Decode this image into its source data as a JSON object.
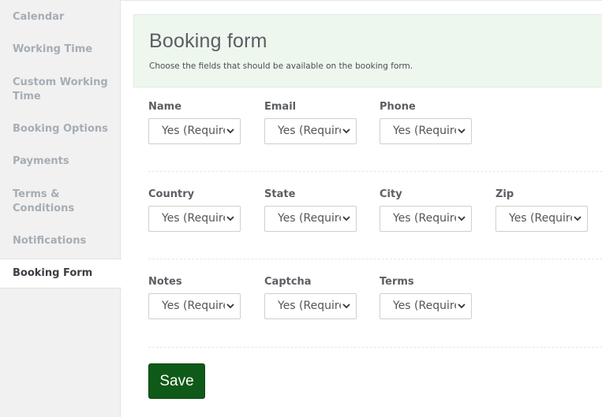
{
  "sidebar": {
    "items": [
      {
        "label": "Calendar"
      },
      {
        "label": "Working Time"
      },
      {
        "label": "Custom Working Time"
      },
      {
        "label": "Booking Options"
      },
      {
        "label": "Payments"
      },
      {
        "label": "Terms & Conditions"
      },
      {
        "label": "Notifications"
      },
      {
        "label": "Booking Form",
        "active": true
      }
    ]
  },
  "header": {
    "title": "Booking form",
    "description": "Choose the fields that should be available on the booking form."
  },
  "fields": {
    "name": {
      "label": "Name",
      "value": "Yes (Required)"
    },
    "email": {
      "label": "Email",
      "value": "Yes (Required)"
    },
    "phone": {
      "label": "Phone",
      "value": "Yes (Required)"
    },
    "country": {
      "label": "Country",
      "value": "Yes (Required)"
    },
    "state": {
      "label": "State",
      "value": "Yes (Required)"
    },
    "city": {
      "label": "City",
      "value": "Yes (Required)"
    },
    "zip": {
      "label": "Zip",
      "value": "Yes (Required)"
    },
    "notes": {
      "label": "Notes",
      "value": "Yes (Required)"
    },
    "captcha": {
      "label": "Captcha",
      "value": "Yes (Required)"
    },
    "terms": {
      "label": "Terms",
      "value": "Yes (Required)"
    }
  },
  "save_label": "Save",
  "colors": {
    "save_button": "#0f5a18",
    "header_bg": "#eef7ee",
    "sidebar_bg": "#f1f1f1"
  }
}
